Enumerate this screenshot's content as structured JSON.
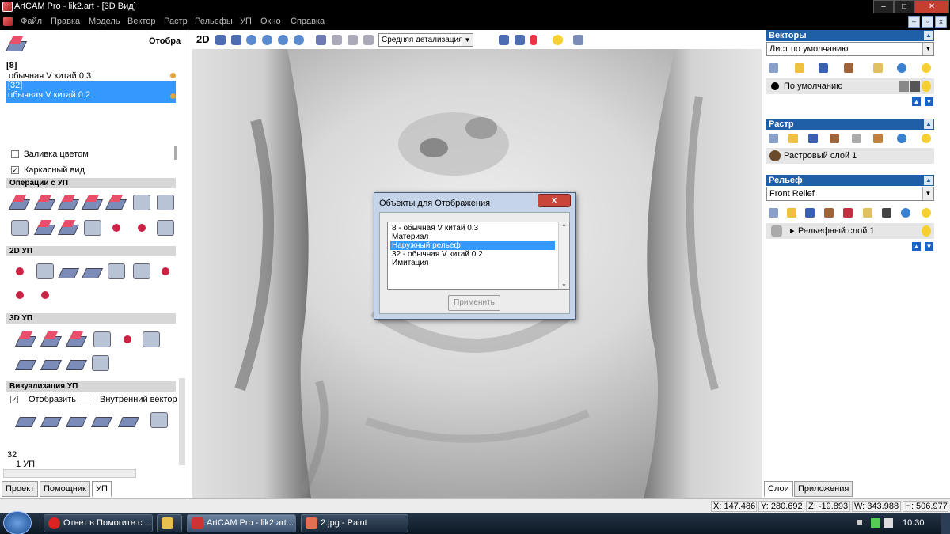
{
  "window": {
    "title": "ArtCAM Pro - lik2.art - [3D Вид]",
    "minimize": "–",
    "maximize": "□",
    "close": "✕"
  },
  "menu": [
    "Файл",
    "Правка",
    "Модель",
    "Вектор",
    "Растр",
    "Рельефы",
    "УП",
    "Окно",
    "Справка"
  ],
  "mdi": {
    "min": "–",
    "restore": "▫",
    "close": "x"
  },
  "left": {
    "panel_title": "Отобра",
    "toolpaths": [
      {
        "id": "[8]",
        "name": "обычная V китай 0.3",
        "selected": false
      },
      {
        "id": "[32]",
        "name": "обычная V китай 0.2",
        "selected": true
      }
    ],
    "color_fill_label": "Заливка цветом",
    "color_fill_checked": false,
    "wireframe_label": "Каркасный вид",
    "wireframe_checked": true,
    "sections": {
      "ops": "Операции с УП",
      "toolpath2d": "2D УП",
      "toolpath3d": "3D УП",
      "visual": "Визуализация УП"
    },
    "show_label": "Отобразить",
    "show_checked": true,
    "inner_vector_label": "Внутренний вектор",
    "inner_vector_checked": false,
    "bottom_id": "32",
    "bottom_item": "1 УП",
    "tabs": [
      "Проект",
      "Помощник",
      "УП"
    ]
  },
  "toolbar": {
    "mode_2d": "2D",
    "detail": "Средняя детализация",
    "detail_arrow": "▼"
  },
  "dialog": {
    "title": "Объекты для Отображения",
    "close": "x",
    "items": [
      "8 - обычная V китай 0.3",
      "Материал",
      "Наружный рельеф",
      "32 - обычная V китай 0.2",
      "Имитация"
    ],
    "selected_index": 2,
    "apply": "Применить",
    "scroll_up": "▲",
    "scroll_down": "▼"
  },
  "right": {
    "vectors": {
      "title": "Векторы",
      "collapse": "▲",
      "sheet": "Лист по умолчанию",
      "layer": "По умолчанию"
    },
    "raster": {
      "title": "Растр",
      "collapse": "▲",
      "layer": "Растровый слой 1"
    },
    "relief": {
      "title": "Рельеф",
      "collapse": "▲",
      "sheet": "Front Relief",
      "layer": "Рельефный слой 1"
    },
    "arrow": "▼",
    "up": "▲",
    "down": "▼",
    "expand": "▸",
    "tabs": [
      "Слои",
      "Приложения"
    ]
  },
  "status": {
    "x": "X: 147.486",
    "y": "Y: 280.692",
    "z": "Z: -19.893",
    "w": "W: 343.988",
    "h": "H: 506.977"
  },
  "taskbar": {
    "tasks": [
      "Ответ в Помогите с ...",
      "",
      "ArtCAM Pro - lik2.art...",
      "2.jpg - Paint"
    ],
    "time": "10:30"
  },
  "colors": {
    "accent": "#1f5fa8",
    "selection": "#3399ff",
    "close": "#c8453a"
  }
}
